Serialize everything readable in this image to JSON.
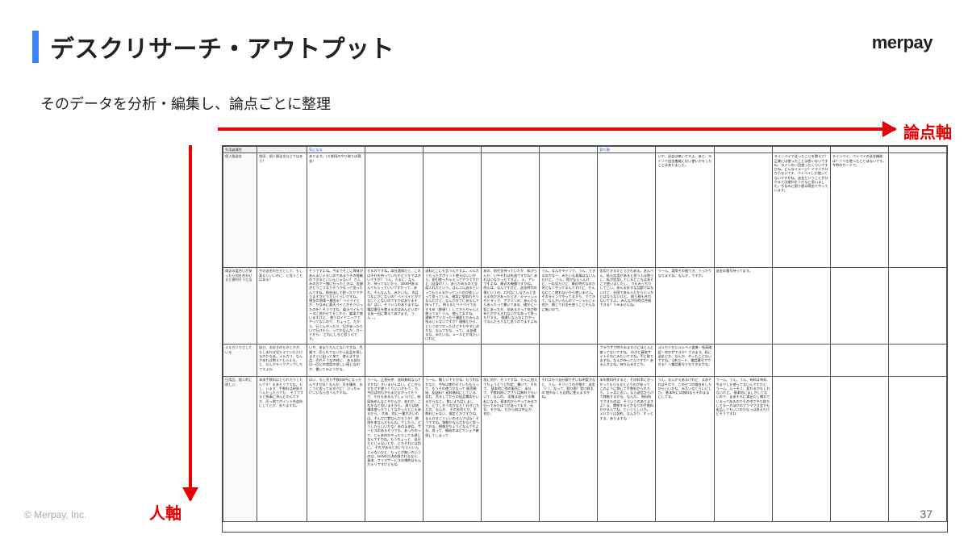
{
  "title": "デスクリサーチ・アウトプット",
  "brand": "merpay",
  "subtitle": "そのデータを分析・編集し、論点ごとに整理",
  "axes": {
    "horizontal": "論点軸",
    "vertical": "人軸"
  },
  "copyright": "© Merpay, Inc.",
  "page": "37",
  "matrix": {
    "col_headers": [
      "利用者属性",
      "",
      "気になる",
      "",
      "",
      "",
      "",
      "割り勘",
      "",
      "",
      "",
      "",
      ""
    ],
    "rows": [
      {
        "h": "r-tall",
        "label1": "個人間送金",
        "label2": "普段、個人間送金などではあり？",
        "cells": [
          "あります。（※普段のやり取りは現金）",
          "",
          "",
          "",
          "",
          "",
          "いや、送金は無いですよ。あと、ラインで送金機能に近い使い方をしたことはありました。",
          "",
          "ラインペイで送ったことを教えて？正確には使ったことは思いないですね、ラインの一回使ったくらいですかね。どんなイメージ？イマイチ分からないです、ペイペイしか使ってないですかね。送金ということが分かるとは便利そうだなと思いました。ちなみに割り勘は現金でやっています。",
          "ラインペイ、ペイペイの送金機能は？一つも使ったことはないです。今時のカードで。",
          "",
          "",
          ""
        ]
      },
      {
        "h": "r-mid",
        "label1": "満足の度合いがあったら何を合わせると便利そうだな",
        "label2": "今の送金の仕方として、もし楽ならいいのに、と思うことはある？",
        "cells": [
          "そうですよね。今までそこに興味があんまじゃないのであまりその経験のできるといいんじゃない？\nさんみの方で一緒に行ったときは、金額がどうこうなりそうかなって思ったんですね。前金出して割ったりでやりますかどりたいくらいですね。\n\n現金の領域一番困る？ベイペイとか、ちなみに楽天ペイとかそういったのを？そうですね、楽天ペイもペースに合わせてそこから、電車で使いますけど、\n\n使うロイドニックでやってないので、\n\nちょっと、だから、行くんやったり、日があったりいで行けたら、ってかなんか、カードから、\nどれにしろと思うんです。",
          "するのですね。本社通知だと、これはそれを持っていたかどうかではきいですが？\nうん、たまに、なんか、持ってないから、3000円あるんでもらっていいですかって、あれ、そんなんだ、みたいな。\n\n尚且つなにかこないの？ペイペイとかでなに？とないのですかはありますね？はい、そういうのありますね。\n\n電話番号を教えるのはめんどいの？まあ一回に教えてあげます。\nうん…。",
          "送料どこにも言うんですよ。メルカリだったかポイント使えばいいから、割引使っちゃえってやつですけど（自身の？）、あらためるので全部入れたという。はんぶん送るといってもらえるかっていうのが欲しいって思っている、確実に受取れそうなんだけど、なんかすでにあるんで持ってて。\n\n例えるとペイペイでおすすめ（数値？）してからちゃんと使ってる？うん、使ってますね。\n\n通帳アプリだったら履歴とかみんな残るじゃないですか？通帳だから、というのつかったけどやりやすいのかな、なんでかな、って。\nまあ通るな、みたいな。メールとか見たいけれど、",
          "あの、前代金持っていたか、私がらんか、いやそれは先週ですかね？あれはいなかったですよ。\n\nえ、アレですよね、最近の機種ですかね。\n\n例えば、なんですけど、送金時代の僕というの、2か月にしなさんと言える何かがあったとき、キャッシュやドラッグ、アマゾンの、あんたならあったって書いてある、確かに一覧にあったか、何あるかって何が財布とかかえきれないかなあって思ったりする。\n\n間違いならなにかやってるんだろうなと思うのでますよね",
          "うん、なんかラインで、うん、できるのかなー、みたいな表情はないんだけど。\n\nうん、得がならへんけど、一応見たけど、最近時代なのか何となくやってるんですけど、そんなにここ使わないから使いません。そのラインでやってるから、でてきて。なんかいろんのソーシャルじゃ何か、閉じてお金を使うことそんなに無いので。",
          "信用できるかどうかもある。あんぺん、私も信用があると思う人は使うし、私が信用しているところはあそこで使いましたし、\nでもみっちりしてこい。あんま好きな話題ではないけど、全国である人だからいっかとはならないけど。\n\n割り勘も合わないですよ。\n\nみんなが同時点合格できる？うみませんね。",
          "うーん、実際その間でき、うっかりなりますね、なんか、ですか。",
          "送金の番号持ってます。",
          "",
          "",
          "",
          ""
        ]
      },
      {
        "h": "r-short",
        "label1": "メルカリでさしている",
        "label2": "部分、お好きのものとかが、もしあれば見たえていただけるのかなあ。メルカリ、なんかあれば教えてもらえる、と、なんかライクアップしたですよね",
        "cells": [
          "いや、あまりたんにないですね、売買で、売られてないから出品を探しますぐに出って来て、使えますな品、売れそうなの時に、\n\nある部分は一回どの程度の欲しい感じなのか、書いてみようかな、",
          "",
          "",
          "",
          "",
          "ブラウザで時々みますけどほとんど使ってないですね。\nのびと買取サイトそれにみたいですね。手に取りますね。なんか持ってんですか？あるんすよね。持ち込みすごか。",
          "メルカリからメルペイ連携・残高確認・何かができか？できます。私に送金とか、なんか、やったことないですね。\nQRコード、電話番号でできる？へ電話番号でもできるかな。",
          "",
          "",
          "",
          "",
          ""
        ]
      },
      {
        "h": "r-big",
        "label1": "日用品、個人的に欲しい、",
        "label2": "本来手数料はとられたりしたんです？まあそうですね。もし、います、手数料は頑張ろうんだったらでも、\nそうですると無事に済んどのんですか、売っ側でポイント合血的にしてとか、ありますね。",
        "cells": [
          "はい、もし売り手数料0円になったんですかね？なんか、気を優先、おこうと思ってますけど？\nぶっちゃけいいなら合うんですね。",
          "うーん、正直元件、送料無料なんですかね？すいませんはい。どこからすかさず使うくりいいかもう、で。\n今回は何もかもまだ分かってそうで、それもあるんでしょうけど。結局始めんなとやかんか、あれか、これかなと思いますから。\n\n周りは結構本使ったりしてなかったとこもあるから、\n大体、特に一番大きいのは、そんだけ数なんだろうか？\n\n期限を来なんだもんね、でしたら。どうしたらいいかな？あのまあね、サービスのあるそうでも、あっちのって、じゃあ何かやったりしてる感じなんですかね。もうちょっと、自分だとじゃないとか、とかそれとは別に。\nそれがあるとおいたらいいんじゃないかと、もっとが無いのいうのは、NANDさ決め限されるなら、\n\n基本、フリマサービスの規約はもんだキリですけどもね",
          "う一ん、難しいですかね、もう別なかなと、今年は使わせといたもらって、もうそれ使つかなって\n\n販売開始、配送料？送料無料にしている、含む、売るしてからの出品費用もいるからなと。\n\n数いまち話しました、どうしかうのかなと？好きいただの、なんか、\nその金利とか、手数料じゃない、限定とかですかね、なんかすごくいいのせんではな？そうですね。移動かなんだかなと思っておる、想像がちょうどなんですよね、思って、開始のほどでシェア確保してしまって",
          "前に何か、そうですね、たんに加えてちょうどうど判定、書いて、それで、\n\n基本的に他の販売に、半分で、手数料前にアプリは無料でもいいて、なんの。\n\n実質は送ってる無料になる。基本的からやってみるか行ってみたほうが送ってます、元気、すかね。\nだから前は中止か、何か、\n",
          "それはもう自分親でぞいね明度かなと、うん、そういうのが移す、送金（？）、なって、割り勘？受け取るの\n使わなくも自然に使えますかね。",
          "半年数料円すると、その料率にきっかってもらえるというのがあって、\n\nこのように移して手数料かられたら、１ヶ月に近い。なら送信ひらけて移動するかな、なんか。\n\n有料料でできたのは、そういうのありますよ？ま、関係するとかなりの手数料かかるんでね、というらしいか。\n\nメルカリは契約、なんかり、ずっとする、ありますね",
          "うん、なんかえあるけれど、まあそれはそれで、この三つの融合をしたからいいかな、みたいなくらいにしか。\n基本的には無料ならそのままにしてる。",
          "うーん、うん、うん、有料は有料、今までしか使ってないんですけど、うーん、んーそう、変わるかもしれないけど。\n\n基本的にましかしてないので、まあそれに満足だし慣れているってあるのでその中でやり取りしてる一方ほかのフリマクス会でも出品してもいいのかなっは思えたけどそうですね",
          "",
          "",
          "",
          "",
          ""
        ]
      }
    ]
  }
}
